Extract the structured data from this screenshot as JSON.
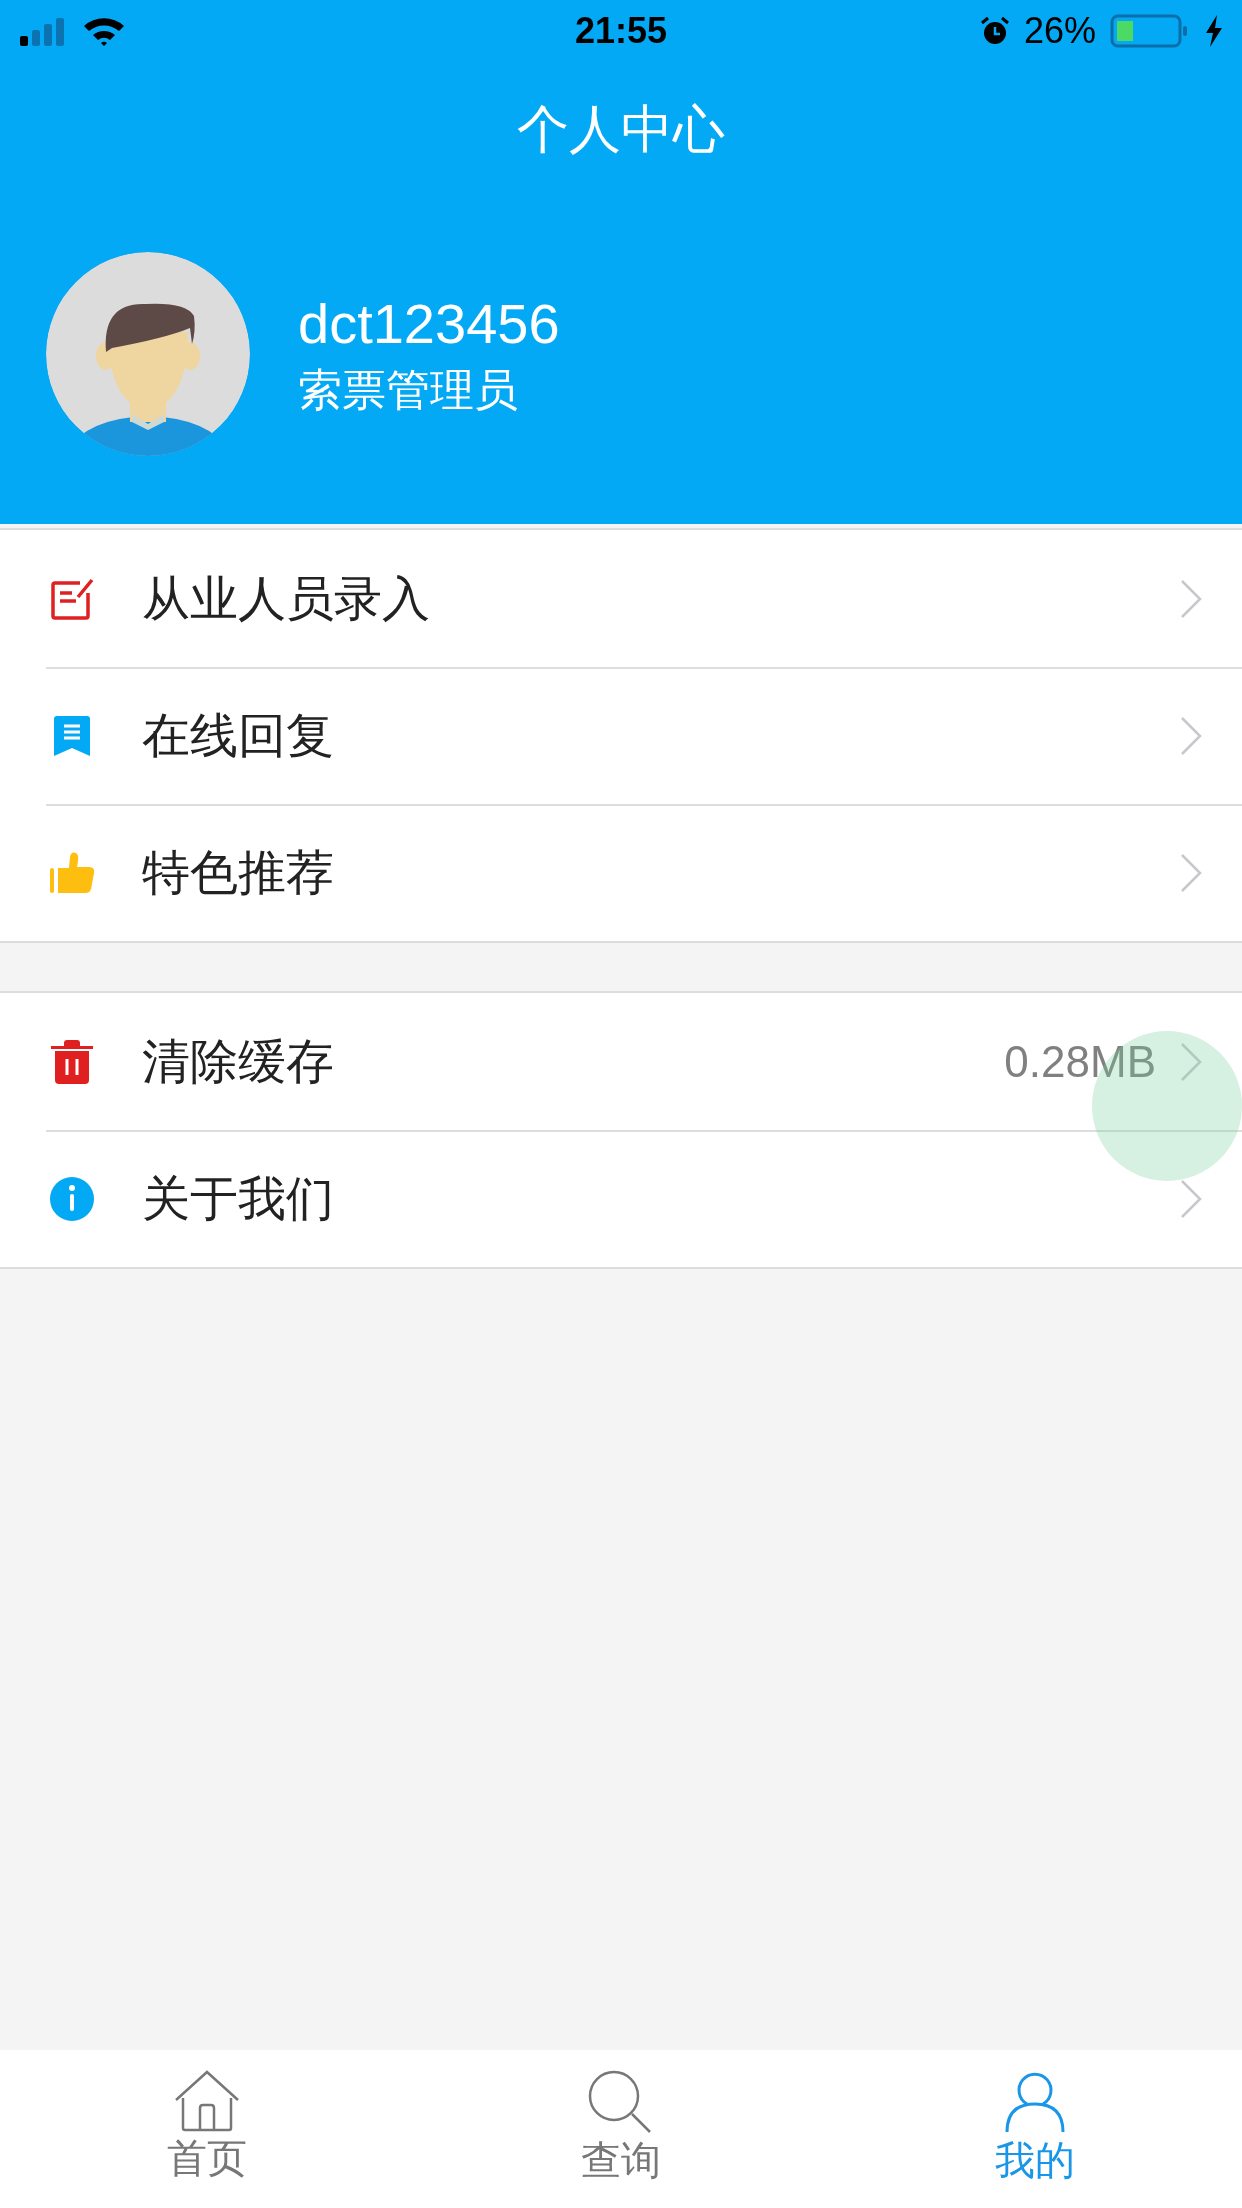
{
  "status_bar": {
    "time": "21:55",
    "battery": "26%"
  },
  "header": {
    "title": "个人中心"
  },
  "profile": {
    "username": "dct123456",
    "role": "索票管理员"
  },
  "menu_groups": [
    {
      "items": [
        {
          "kind": "edit",
          "label": "从业人员录入"
        },
        {
          "kind": "bookmark",
          "label": "在线回复"
        },
        {
          "kind": "thumb",
          "label": "特色推荐"
        }
      ]
    },
    {
      "items": [
        {
          "kind": "trash",
          "label": "清除缓存",
          "value": "0.28MB",
          "pressed": true
        },
        {
          "kind": "info",
          "label": "关于我们",
          "pressed": false
        }
      ]
    }
  ],
  "tab_bar": [
    {
      "kind": "home",
      "label": "首页",
      "selected": false
    },
    {
      "kind": "search",
      "label": "查询",
      "selected": false
    },
    {
      "kind": "user",
      "label": "我的",
      "selected": true
    }
  ]
}
